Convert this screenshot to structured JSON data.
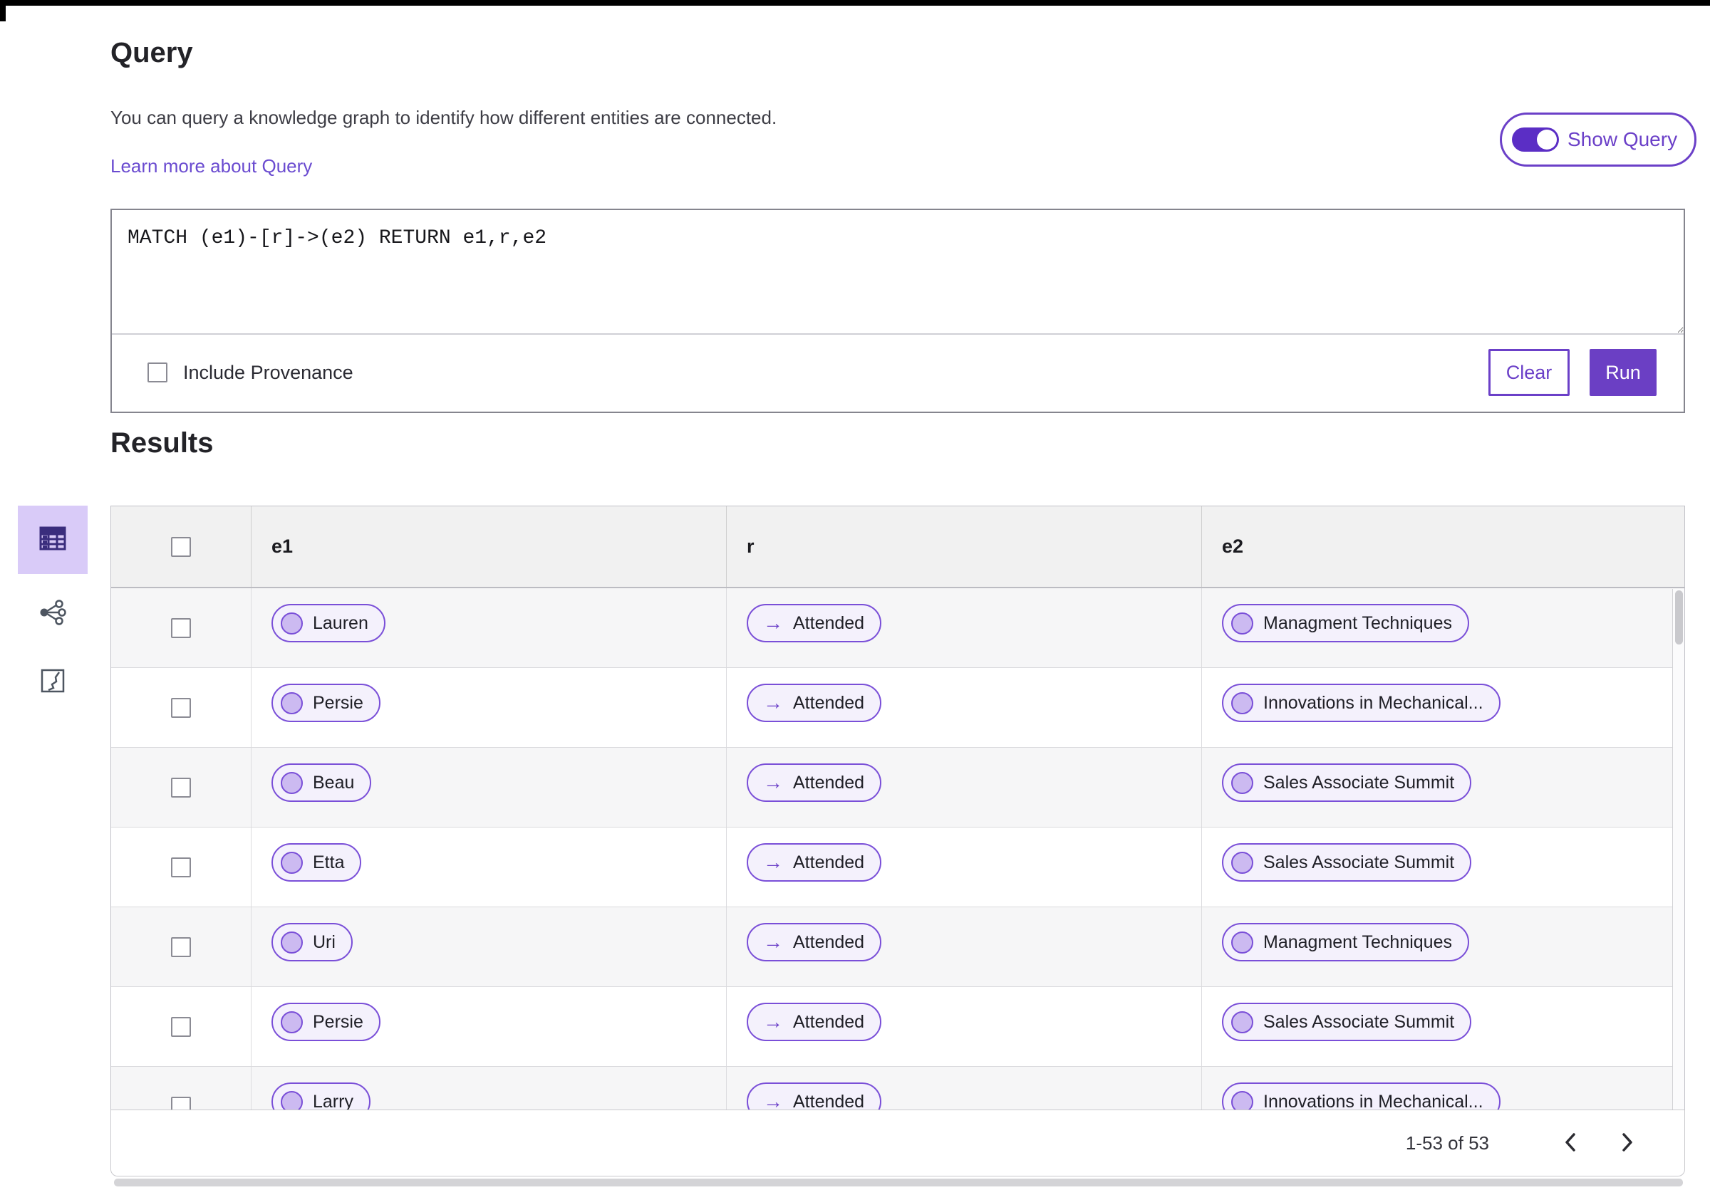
{
  "colors": {
    "accent": "#6b40c8",
    "accent_fill": "#6b3fc4",
    "toggle_track": "#5b2ec5",
    "pill_border": "#7a4fd8",
    "pill_bg": "#f4f1fc",
    "pill_dot": "#ccbaf1",
    "selected_tile_bg": "#d9cbf8",
    "link": "#6a4bd0",
    "table_header_bg": "#f1f1f1",
    "row_stripe_bg": "#f6f6f7"
  },
  "icons": {
    "arrow": "→",
    "view_options": [
      "table-view",
      "graph-view",
      "map-view"
    ],
    "prev": "chevron-left",
    "next": "chevron-right"
  },
  "page": {
    "title": "Query",
    "description": "You can query a knowledge graph to identify how different entities are connected.",
    "learn_more_link": "Learn more about Query"
  },
  "query": {
    "show_query_label": "Show Query",
    "toggle_on": true,
    "text": "MATCH (e1)-[r]->(e2) RETURN e1,r,e2",
    "include_provenance_label": "Include Provenance",
    "include_provenance_checked": false,
    "clear_label": "Clear",
    "run_label": "Run"
  },
  "results": {
    "heading": "Results",
    "columns": [
      "e1",
      "r",
      "e2"
    ],
    "rows": [
      {
        "e1": "Lauren",
        "r": "Attended",
        "e2": "Managment Techniques"
      },
      {
        "e1": "Persie",
        "r": "Attended",
        "e2": "Innovations in Mechanical..."
      },
      {
        "e1": "Beau",
        "r": "Attended",
        "e2": "Sales Associate Summit"
      },
      {
        "e1": "Etta",
        "r": "Attended",
        "e2": "Sales Associate Summit"
      },
      {
        "e1": "Uri",
        "r": "Attended",
        "e2": "Managment Techniques"
      },
      {
        "e1": "Persie",
        "r": "Attended",
        "e2": "Sales Associate Summit"
      },
      {
        "e1": "Larry",
        "r": "Attended",
        "e2": "Innovations in Mechanical..."
      }
    ],
    "pagination": {
      "range_label": "1-53 of 53"
    }
  }
}
